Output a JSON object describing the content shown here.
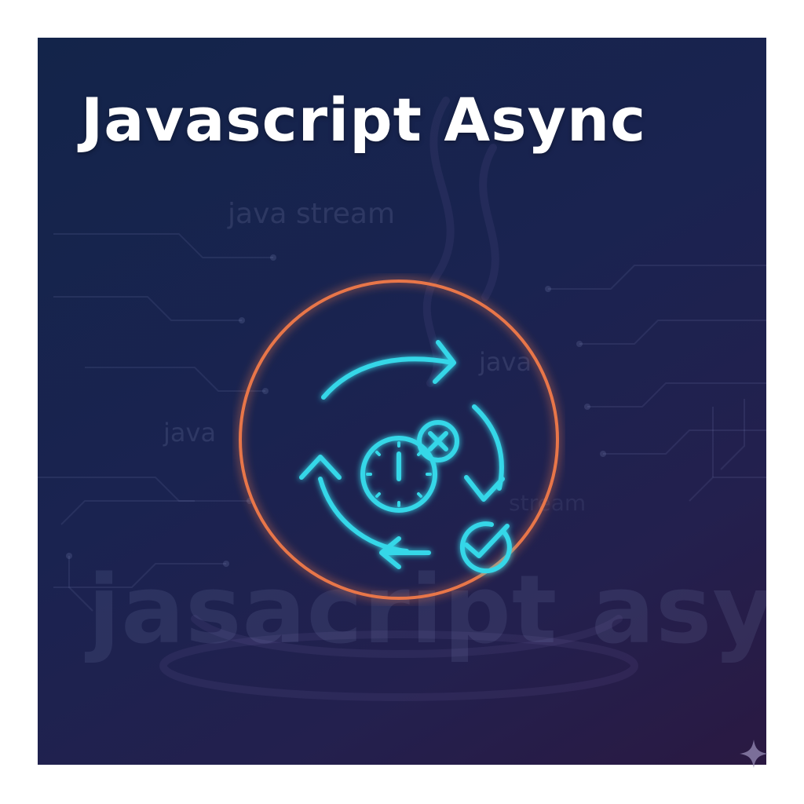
{
  "title": "Javascript Async",
  "watermarks": {
    "stream_top": "java stream",
    "java_right": "java",
    "java_left": "java",
    "stream_right": "stream",
    "big_text": "jasacript async"
  },
  "colors": {
    "background_top": "#13244a",
    "background_bottom": "#2a1942",
    "ring": "#e8764a",
    "icon_glow": "#35d7e8",
    "title": "#ffffff"
  },
  "icons": {
    "emblem": "async-cycle-icon",
    "timer": "stopwatch-icon",
    "cancel": "x-circle-icon",
    "success": "check-circle-icon",
    "corner": "sparkle-icon"
  }
}
